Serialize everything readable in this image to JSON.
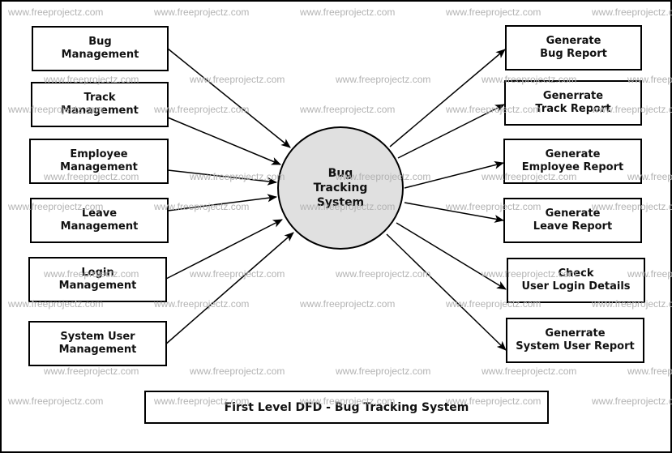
{
  "diagram": {
    "title": "First Level DFD - Bug Tracking System",
    "watermark": "www.freeprojectz.com",
    "process": {
      "lines": [
        "Bug",
        "Tracking",
        "System"
      ]
    },
    "inputs": [
      {
        "id": "bug-management",
        "lines": [
          "Bug",
          "Management"
        ]
      },
      {
        "id": "track-management",
        "lines": [
          "Track",
          "Management"
        ]
      },
      {
        "id": "employee-management",
        "lines": [
          "Employee",
          "Management"
        ]
      },
      {
        "id": "leave-management",
        "lines": [
          "Leave",
          "Management"
        ]
      },
      {
        "id": "login-management",
        "lines": [
          "Login",
          "Management"
        ]
      },
      {
        "id": "system-user-management",
        "lines": [
          "System User",
          "Management"
        ]
      }
    ],
    "outputs": [
      {
        "id": "generate-bug-report",
        "lines": [
          "Generate",
          "Bug Report"
        ]
      },
      {
        "id": "generate-track-report",
        "lines": [
          "Generrate",
          "Track Report"
        ]
      },
      {
        "id": "generate-employee-report",
        "lines": [
          "Generate",
          "Employee Report"
        ]
      },
      {
        "id": "generate-leave-report",
        "lines": [
          "Generate",
          "Leave Report"
        ]
      },
      {
        "id": "check-user-login-details",
        "lines": [
          "Check",
          "User Login Details"
        ]
      },
      {
        "id": "generate-system-user-report",
        "lines": [
          "Generrate",
          "System User Report"
        ]
      }
    ],
    "flows": [
      {
        "from": "bug-management",
        "to": "process"
      },
      {
        "from": "track-management",
        "to": "process"
      },
      {
        "from": "employee-management",
        "to": "process"
      },
      {
        "from": "leave-management",
        "to": "process"
      },
      {
        "from": "login-management",
        "to": "process"
      },
      {
        "from": "system-user-management",
        "to": "process"
      },
      {
        "from": "process",
        "to": "generate-bug-report"
      },
      {
        "from": "process",
        "to": "generate-track-report"
      },
      {
        "from": "process",
        "to": "generate-employee-report"
      },
      {
        "from": "process",
        "to": "generate-leave-report"
      },
      {
        "from": "process",
        "to": "check-user-login-details"
      },
      {
        "from": "process",
        "to": "generate-system-user-report"
      }
    ]
  }
}
